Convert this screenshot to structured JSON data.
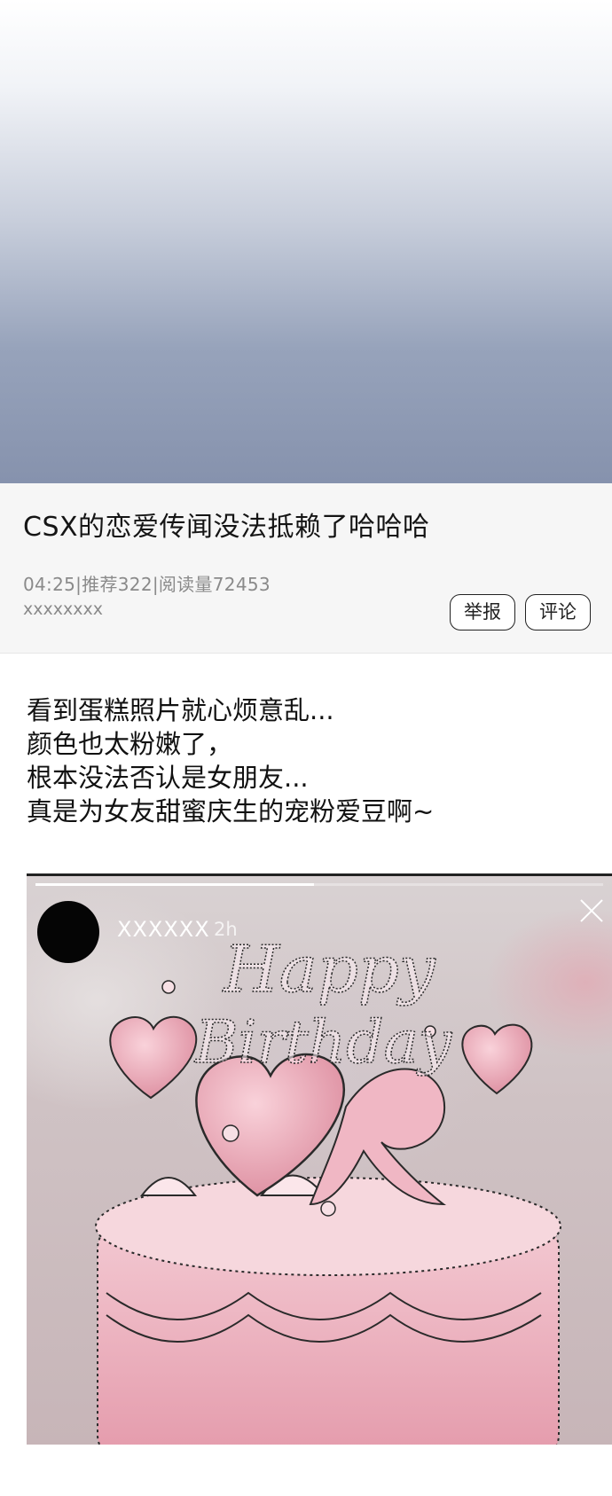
{
  "post": {
    "title": "CSX的恋爱传闻没法抵赖了哈哈哈",
    "meta": "04:25|推荐322|阅读量72453",
    "author": "xxxxxxxx",
    "report_label": "举报",
    "comment_label": "评论"
  },
  "body": {
    "lines": [
      "看到蛋糕照片就心烦意乱...",
      "颜色也太粉嫩了，",
      "根本没法否认是女朋友...",
      "真是为女友甜蜜庆生的宠粉爱豆啊~"
    ]
  },
  "story": {
    "username": "XXXXXX",
    "time": "2h",
    "progress": 0.49,
    "cake_text_line1": "Happy",
    "cake_text_line2": "Birthday"
  },
  "colors": {
    "cake_pink": "#e9a9b6",
    "hero_bottom": "#8692ad"
  },
  "icons": {
    "close": "close-icon",
    "avatar": "avatar"
  }
}
